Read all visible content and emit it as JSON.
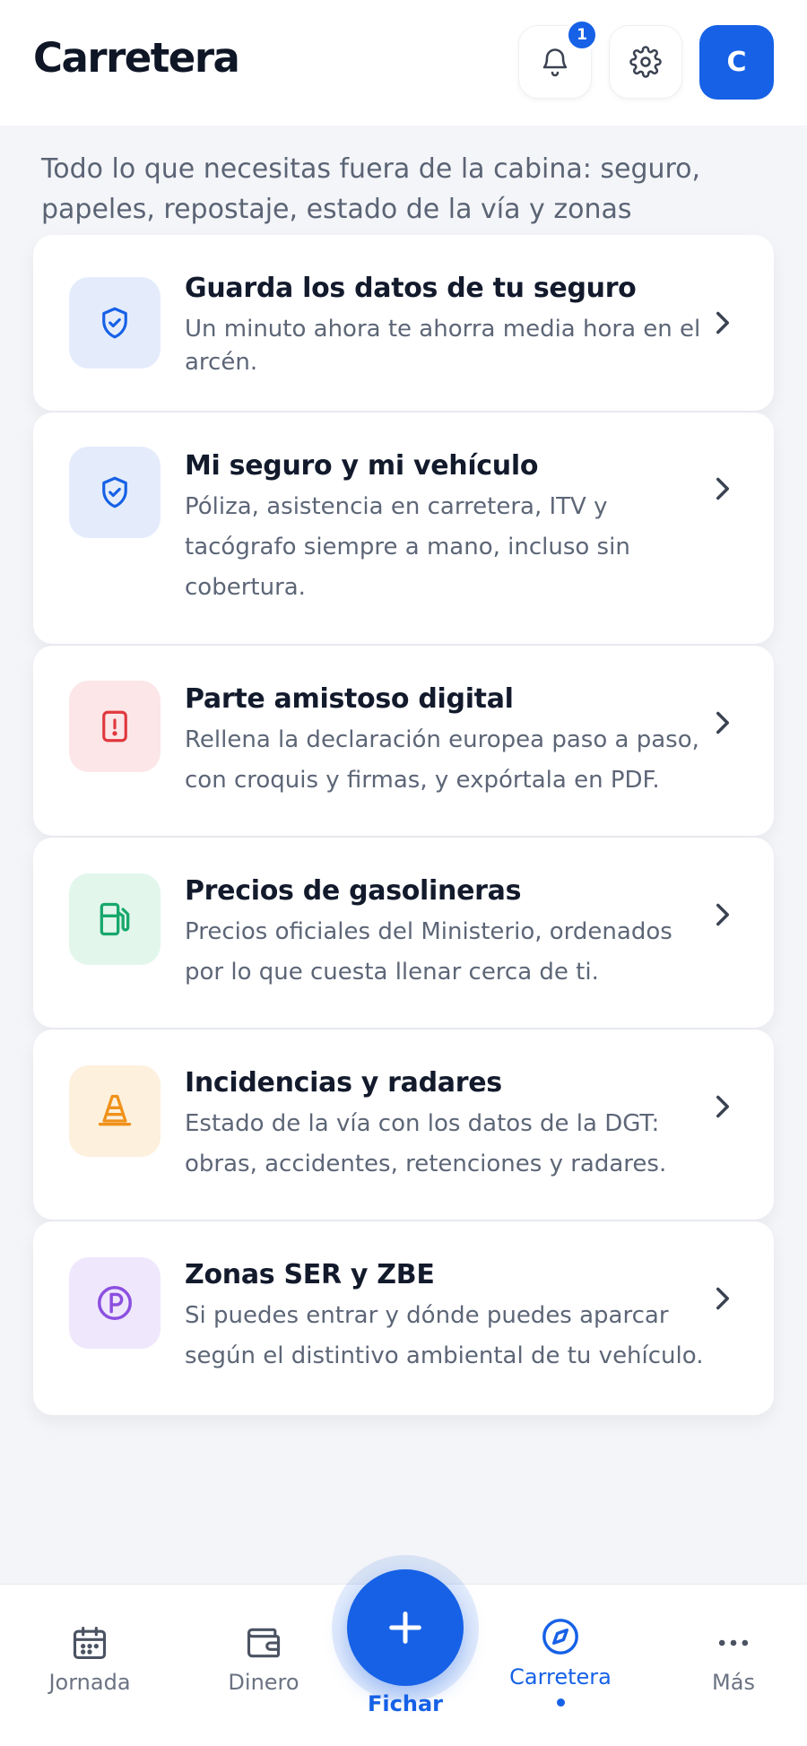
{
  "header": {
    "title": "Carretera",
    "notifications_count": "1",
    "avatar_initial": "C"
  },
  "intro": "Todo lo que necesitas fuera de la cabina: seguro, papeles, repostaje, estado de la vía y zonas restringidas.",
  "cards": [
    {
      "title": "Guarda los datos de tu seguro",
      "desc": "Un minuto ahora te ahorra media hora en el arcén.",
      "icon": "shield-check-icon",
      "color": "#1661e6",
      "tile_bg": "#e4ecfc"
    },
    {
      "title": "Mi seguro y mi vehículo",
      "desc": "Póliza, asistencia en carretera, ITV y tacógrafo siempre a mano, incluso sin cobertura.",
      "icon": "shield-check-icon",
      "color": "#1661e6",
      "tile_bg": "#e4ecfc"
    },
    {
      "title": "Parte amistoso digital",
      "desc": "Rellena la declaración europea paso a paso, con croquis y firmas, y expórtala en PDF.",
      "icon": "alert-document-icon",
      "color": "#e0383e",
      "tile_bg": "#fce6e7"
    },
    {
      "title": "Precios de gasolineras",
      "desc": "Precios oficiales del Ministerio, ordenados por lo que cuesta llenar cerca de ti.",
      "icon": "fuel-pump-icon",
      "color": "#17a86b",
      "tile_bg": "#e2f6ec"
    },
    {
      "title": "Incidencias y radares",
      "desc": "Estado de la vía con los datos de la DGT: obras, accidentes, retenciones y radares.",
      "icon": "traffic-cone-icon",
      "color": "#f0911a",
      "tile_bg": "#fdf0dc"
    },
    {
      "title": "Zonas SER y ZBE",
      "desc": "Si puedes entrar y dónde puedes aparcar según el distintivo ambiental de tu vehículo.",
      "icon": "parking-icon",
      "color": "#8b4fe0",
      "tile_bg": "#efe7fc"
    }
  ],
  "nav": {
    "jornada": "Jornada",
    "dinero": "Dinero",
    "fichar": "Fichar",
    "carretera": "Carretera",
    "mas": "Más"
  },
  "colors": {
    "accent": "#1661e6",
    "text_primary": "#121a2c",
    "text_secondary": "#5d6677"
  }
}
